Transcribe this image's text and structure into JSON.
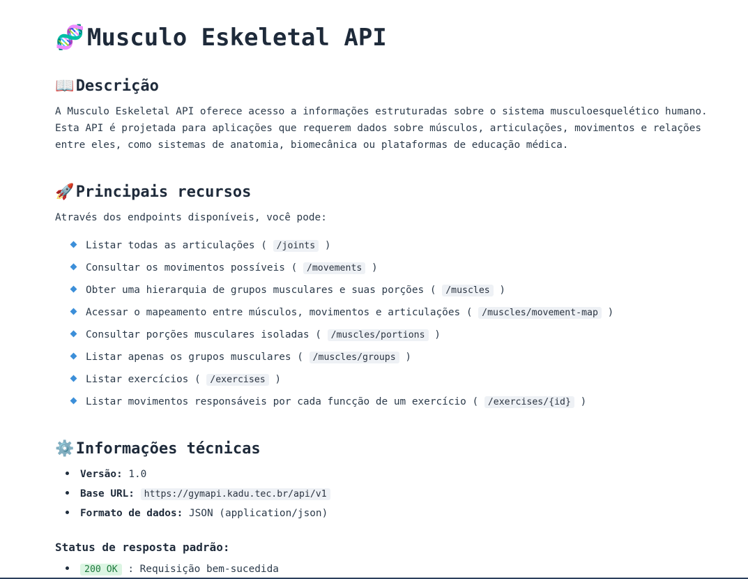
{
  "title": {
    "icon": "dna-icon",
    "emoji": "🧬",
    "text": "Musculo Eskeletal API"
  },
  "description": {
    "emoji": "📖",
    "heading": "Descrição",
    "lines": [
      "A Musculo Eskeletal API oferece acesso a informações estruturadas sobre o sistema musculoesquelético humano.",
      "Esta API é projetada para aplicações que requerem dados sobre músculos, articulações, movimentos e relações",
      "entre eles, como sistemas de anatomia, biomecânica ou plataformas de educação médica."
    ]
  },
  "features": {
    "emoji": "🚀",
    "heading": "Principais recursos",
    "intro": "Através dos endpoints disponíveis, você pode:",
    "bullet_color": "#3c8fd9",
    "items": [
      {
        "text": "Listar todas as articulações",
        "endpoint": "/joints"
      },
      {
        "text": "Consultar os movimentos possíveis",
        "endpoint": "/movements"
      },
      {
        "text": "Obter uma hierarquia de grupos musculares e suas porções",
        "endpoint": "/muscles"
      },
      {
        "text": "Acessar o mapeamento entre músculos, movimentos e articulações",
        "endpoint": "/muscles/movement-map"
      },
      {
        "text": "Consultar porções musculares isoladas",
        "endpoint": "/muscles/portions"
      },
      {
        "text": "Listar apenas os grupos musculares",
        "endpoint": "/muscles/groups"
      },
      {
        "text": "Listar exercícios",
        "endpoint": "/exercises"
      },
      {
        "text": "Listar movimentos responsáveis por cada funcção de um exercício",
        "endpoint": "/exercises/{id}"
      }
    ]
  },
  "technical": {
    "emoji": "⚙️",
    "heading": "Informações técnicas",
    "version_label": "Versão:",
    "version_value": "1.0",
    "base_url_label": "Base URL:",
    "base_url_value": "https://gymapi.kadu.tec.br/api/v1",
    "format_label": "Formato de dados:",
    "format_value": "JSON (application/json)"
  },
  "status": {
    "heading": "Status de resposta padrão:",
    "items": [
      {
        "code": "200 OK",
        "text": ": Requisição bem-sucedida",
        "color": "#1d7a3c"
      }
    ]
  }
}
